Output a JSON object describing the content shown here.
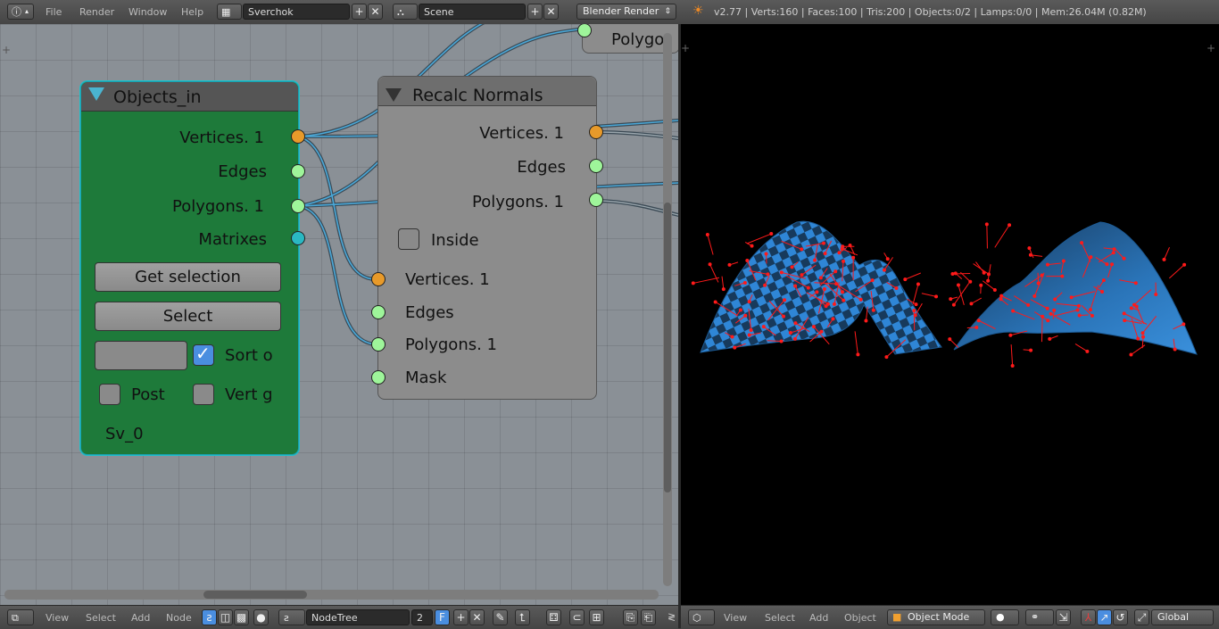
{
  "topbar": {
    "menus": [
      "File",
      "Render",
      "Window",
      "Help"
    ],
    "screen_layout": "Sverchok",
    "scene": "Scene",
    "render_engine": "Blender Render",
    "stats": "v2.77 | Verts:160 | Faces:100 | Tris:200 | Objects:0/2 | Lamps:0/0 | Mem:26.04M (0.82M)"
  },
  "node_objects_in": {
    "title": "Objects_in",
    "outputs": [
      "Vertices. 1",
      "Edges",
      "Polygons. 1",
      "Matrixes"
    ],
    "get_selection_label": "Get selection",
    "select_label": "Select",
    "sort_label": "Sort o",
    "post_label": "Post",
    "vert_label": "Vert g",
    "name_label": "Sv_0"
  },
  "node_recalc": {
    "title": "Recalc Normals",
    "outputs": [
      "Vertices. 1",
      "Edges",
      "Polygons. 1"
    ],
    "inside_label": "Inside",
    "inputs": [
      "Vertices. 1",
      "Edges",
      "Polygons. 1",
      "Mask"
    ]
  },
  "node_partial": {
    "label": "Polygo"
  },
  "node_bottom": {
    "menus": [
      "View",
      "Select",
      "Add",
      "Node"
    ],
    "nodetree": "NodeTree",
    "users": "2",
    "fake_user": "F"
  },
  "view3d_bottom": {
    "menus": [
      "View",
      "Select",
      "Add",
      "Object"
    ],
    "mode": "Object Mode",
    "orientation": "Global"
  },
  "colors": {
    "node_green": "#1e7a3a",
    "socket_orange": "#e89a2a",
    "socket_green": "#9ef59a",
    "socket_cyan": "#2ab8c2",
    "mesh_blue": "#2f86d6",
    "normals_red": "#ff1a1a"
  }
}
